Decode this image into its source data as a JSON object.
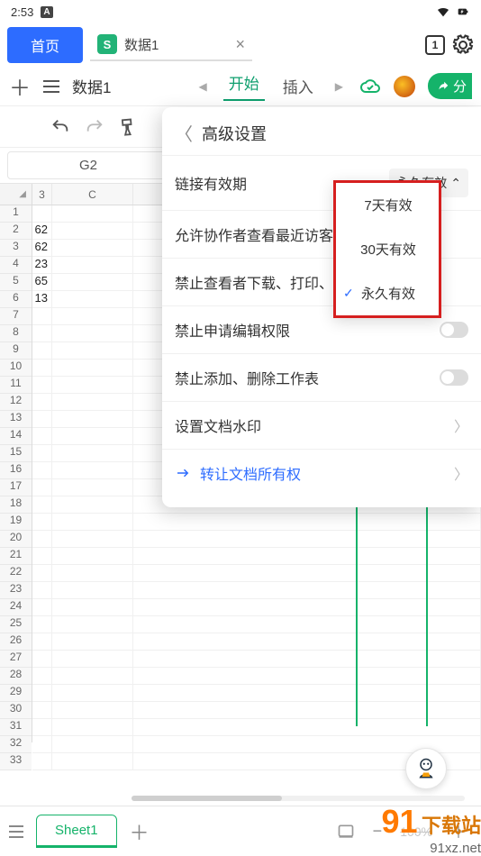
{
  "status_bar": {
    "time": "2:53",
    "badge": "A"
  },
  "tabs": {
    "home_label": "首页",
    "doc_name": "数据1",
    "tab_count": "1"
  },
  "toolbar": {
    "doc_name": "数据1",
    "tab_start": "开始",
    "tab_insert": "插入",
    "share_label": "分"
  },
  "cell_ref": "G2",
  "grid": {
    "col_headers": [
      "3",
      "C"
    ],
    "row_count": 33,
    "data_rows": [
      {
        "b": "62"
      },
      {
        "b": "62"
      },
      {
        "b": "23"
      },
      {
        "b": "65"
      },
      {
        "b": "13"
      }
    ]
  },
  "settings": {
    "title": "高级设置",
    "rows": {
      "validity_label": "链接有效期",
      "validity_value": "永久有效",
      "allow_collab": "允许协作者查看最近访客",
      "forbid_download": "禁止查看者下载、打印、",
      "forbid_edit_perm": "禁止申请编辑权限",
      "forbid_sheets": "禁止添加、删除工作表",
      "watermark": "设置文档水印",
      "transfer": "转让文档所有权"
    }
  },
  "validity_options": {
    "opt_7d": "7天有效",
    "opt_30d": "30天有效",
    "opt_perm": "永久有效"
  },
  "bottom": {
    "sheet_name": "Sheet1",
    "zoom": "100%"
  },
  "watermark": {
    "logo": "91",
    "suffix": "下载站",
    "url": "91xz.net"
  }
}
